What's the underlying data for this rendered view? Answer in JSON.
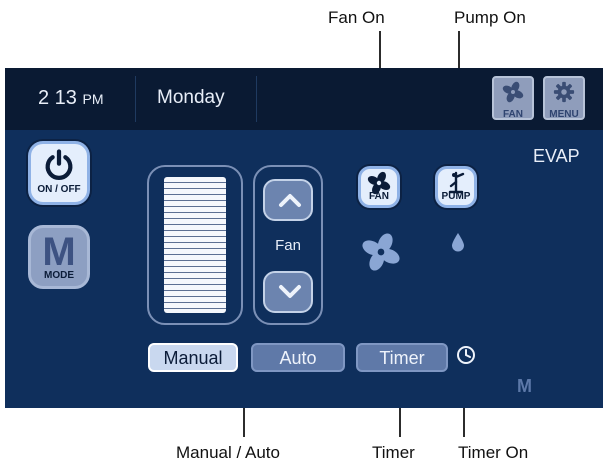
{
  "callouts": {
    "fan_on": "Fan On",
    "pump_on": "Pump On",
    "manual_auto": "Manual / Auto",
    "timer": "Timer",
    "timer_on": "Timer On"
  },
  "topbar": {
    "time": "2 13",
    "ampm": "PM",
    "day": "Monday",
    "fan_button_label": "FAN",
    "menu_button_label": "MENU"
  },
  "left_buttons": {
    "onoff_label": "ON / OFF",
    "mode_letter": "M",
    "mode_label": "MODE"
  },
  "fan_control": {
    "label": "Fan",
    "speed_level": 1.0
  },
  "status_buttons": {
    "fan_label": "FAN",
    "pump_label": "PUMP"
  },
  "modes": {
    "manual": "Manual",
    "auto": "Auto",
    "timer": "Timer",
    "selected": "Manual"
  },
  "evap_label": "EVAP",
  "mode_indicator": "M",
  "colors": {
    "panel": "#0f2f5c",
    "topbar": "#0a1a33",
    "active_button": "#e4eefc",
    "accent_border": "#8fb2e6",
    "status_icon": "#8aa6d4"
  }
}
